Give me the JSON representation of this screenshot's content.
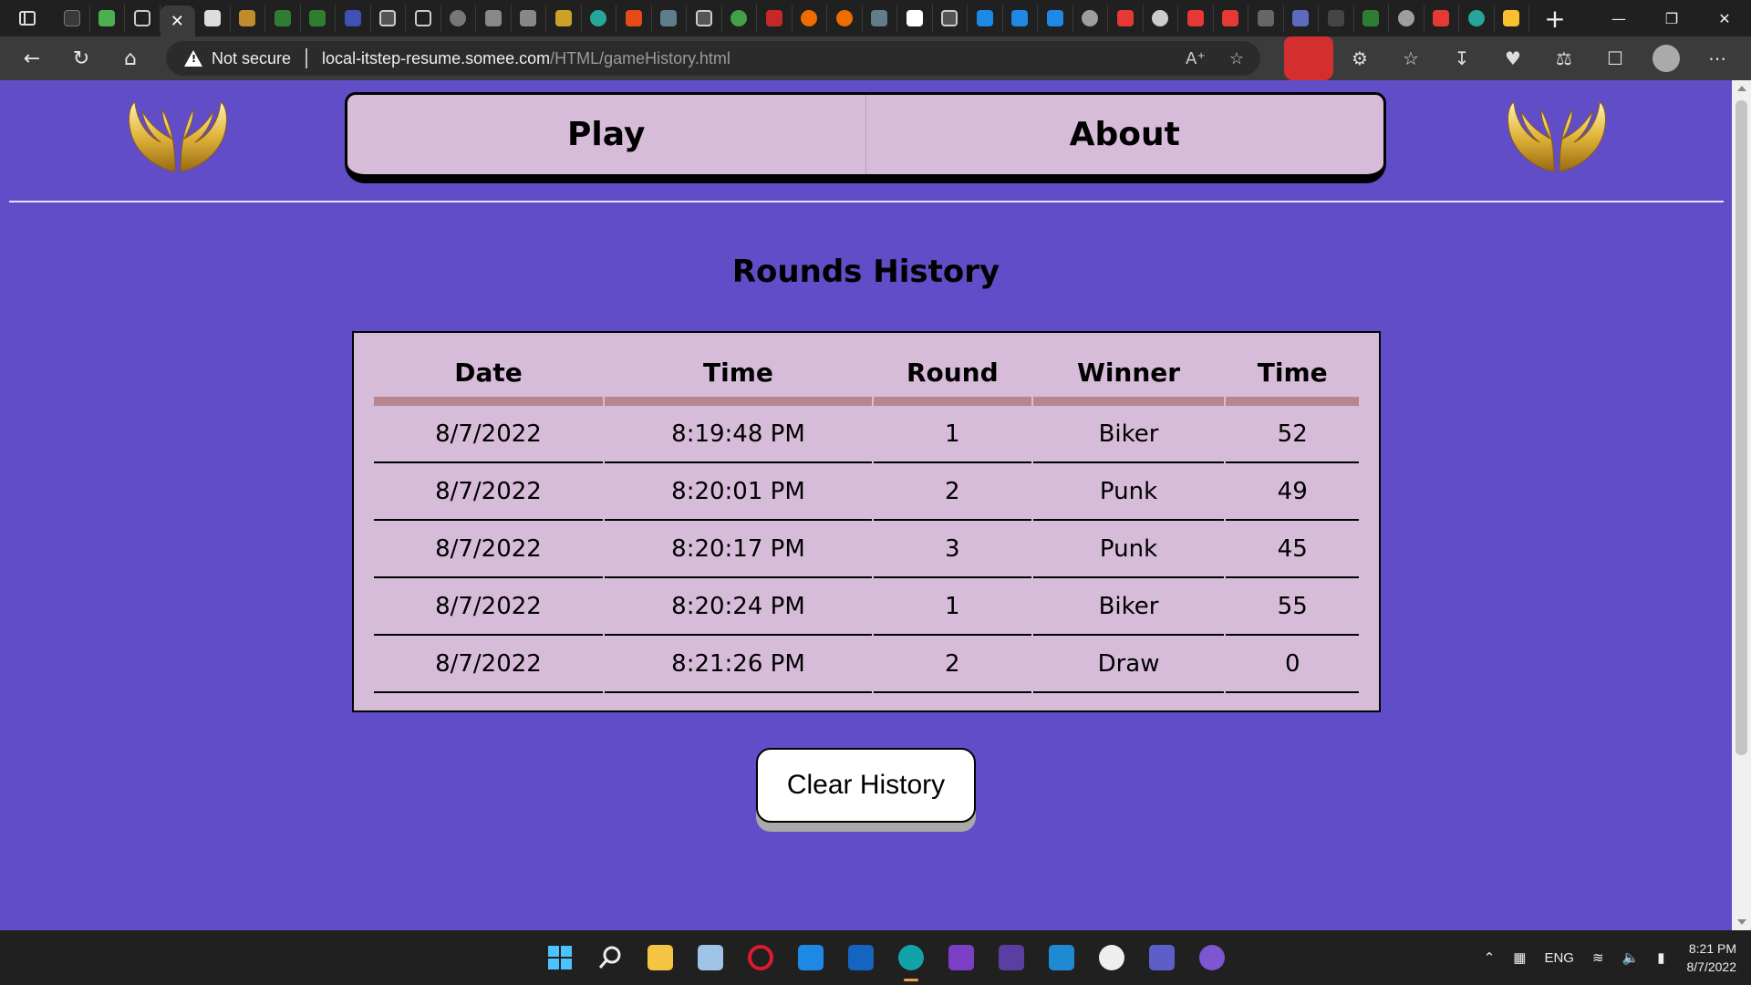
{
  "browser": {
    "address": {
      "security_label": "Not secure",
      "url_host": "local-itstep-resume.somee.com",
      "url_path": "/HTML/gameHistory.html"
    },
    "close_tab_glyph": "✕",
    "new_tab_glyph": "+"
  },
  "page": {
    "nav": {
      "play_label": "Play",
      "about_label": "About"
    },
    "title": "Rounds History",
    "table": {
      "headers": [
        "Date",
        "Time",
        "Round",
        "Winner",
        "Time"
      ],
      "rows": [
        [
          "8/7/2022",
          "8:19:48 PM",
          "1",
          "Biker",
          "52"
        ],
        [
          "8/7/2022",
          "8:20:01 PM",
          "2",
          "Punk",
          "49"
        ],
        [
          "8/7/2022",
          "8:20:17 PM",
          "3",
          "Punk",
          "45"
        ],
        [
          "8/7/2022",
          "8:20:24 PM",
          "1",
          "Biker",
          "55"
        ],
        [
          "8/7/2022",
          "8:21:26 PM",
          "2",
          "Draw",
          "0"
        ]
      ]
    },
    "clear_button_label": "Clear History"
  },
  "taskbar": {
    "language": "ENG",
    "time": "8:21 PM",
    "date": "8/7/2022"
  },
  "colors": {
    "page_background": "#614dc8",
    "nav_background": "#d7bcd9",
    "header_underline": "#b6858f"
  }
}
